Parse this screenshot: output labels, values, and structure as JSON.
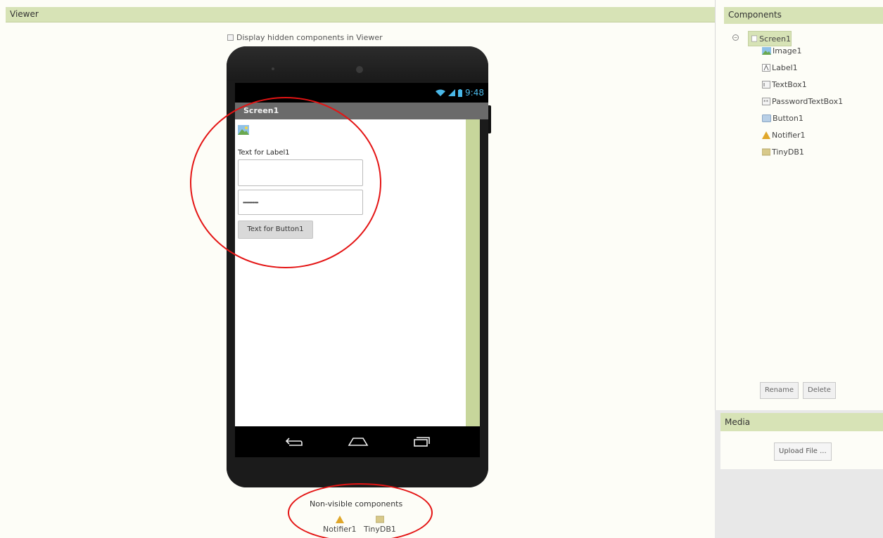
{
  "viewer": {
    "title": "Viewer",
    "hidden_toggle_label": "Display hidden components in Viewer",
    "hidden_checked": false
  },
  "phone": {
    "time": "9:48",
    "screen_title": "Screen1",
    "label_text": "Text for Label1",
    "textbox_value": "",
    "password_value": "••••••••••••",
    "button_text": "Text for Button1",
    "nav_icons": [
      "back-icon",
      "home-icon",
      "recent-apps-icon"
    ]
  },
  "non_visible": {
    "title": "Non-visible components",
    "items": [
      {
        "label": "Notifier1",
        "icon": "notifier-icon"
      },
      {
        "label": "TinyDB1",
        "icon": "tinydb-icon"
      }
    ]
  },
  "components": {
    "title": "Components",
    "root": "Screen1",
    "items": [
      {
        "label": "Image1",
        "icon": "image-icon"
      },
      {
        "label": "Label1",
        "icon": "label-icon"
      },
      {
        "label": "TextBox1",
        "icon": "textbox-icon"
      },
      {
        "label": "PasswordTextBox1",
        "icon": "password-textbox-icon"
      },
      {
        "label": "Button1",
        "icon": "button-icon"
      },
      {
        "label": "Notifier1",
        "icon": "notifier-icon"
      },
      {
        "label": "TinyDB1",
        "icon": "tinydb-icon"
      }
    ],
    "rename_label": "Rename",
    "delete_label": "Delete"
  },
  "media": {
    "title": "Media",
    "upload_label": "Upload File ..."
  },
  "colors": {
    "header_green": "#d7e3b6",
    "annotation_red": "#e41414",
    "status_blue": "#4ab8e8"
  }
}
